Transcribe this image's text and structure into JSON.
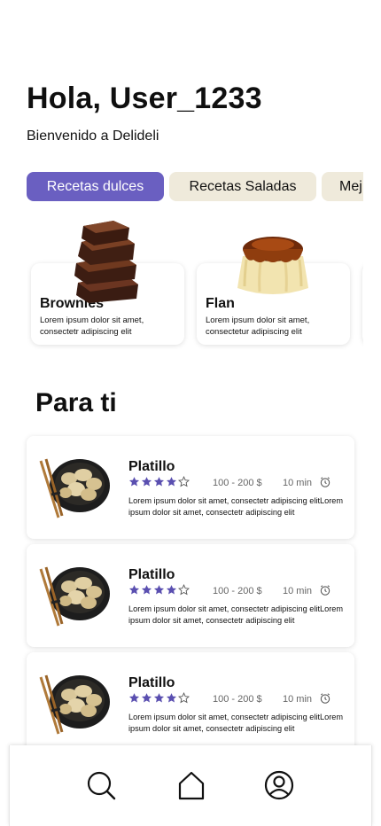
{
  "header": {
    "greeting": "Hola, User_1233",
    "welcome": "Bienvenido a Delideli"
  },
  "tabs": [
    {
      "label": "Recetas dulces",
      "active": true
    },
    {
      "label": "Recetas Saladas",
      "active": false
    },
    {
      "label": "Mej",
      "active": false
    }
  ],
  "featured": [
    {
      "title": "Brownies",
      "desc": "Lorem ipsum dolor sit amet, consectetr adipiscing elit",
      "image_icon": "brownies-image"
    },
    {
      "title": "Flan",
      "desc": "Lorem ipsum dolor sit amet, consectetur adipiscing elit",
      "image_icon": "flan-image"
    }
  ],
  "section": {
    "title": "Para ti"
  },
  "recipes": [
    {
      "name": "Platillo",
      "rating": 4,
      "max_rating": 5,
      "price": "100 - 200 $",
      "time": "10 min",
      "desc": "Lorem ipsum dolor sit amet, consectetr adipiscing elitLorem ipsum dolor sit amet, consectetr adipiscing elit",
      "image_icon": "dumplings-image"
    },
    {
      "name": "Platillo",
      "rating": 4,
      "max_rating": 5,
      "price": "100 - 200 $",
      "time": "10 min",
      "desc": "Lorem ipsum dolor sit amet, consectetr adipiscing elitLorem ipsum dolor sit amet, consectetr adipiscing elit",
      "image_icon": "dumplings-image"
    },
    {
      "name": "Platillo",
      "rating": 4,
      "max_rating": 5,
      "price": "100 - 200 $",
      "time": "10 min",
      "desc": "Lorem ipsum dolor sit amet, consectetr adipiscing elitLorem ipsum dolor sit amet, consectetr adipiscing elit",
      "image_icon": "dumplings-image"
    }
  ],
  "nav": [
    "search-icon",
    "home-icon",
    "profile-icon"
  ],
  "colors": {
    "accent": "#6a5fc1",
    "tab_inactive": "#efeadb",
    "star": "#5a4fb0"
  }
}
